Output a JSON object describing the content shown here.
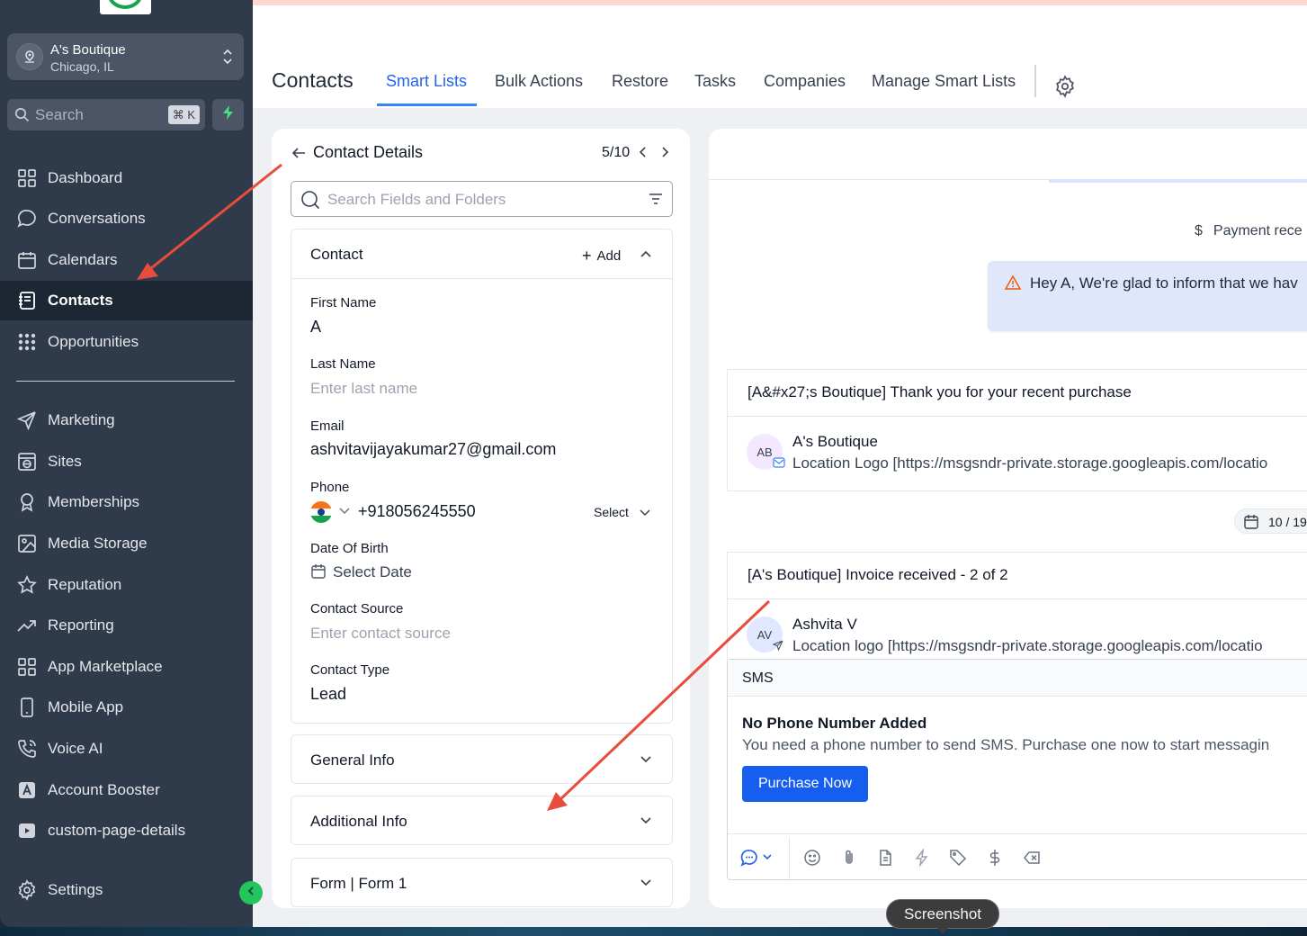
{
  "sidebar": {
    "location": {
      "name": "A's Boutique",
      "city": "Chicago, IL"
    },
    "search": {
      "placeholder": "Search",
      "shortcut": "⌘ K"
    },
    "items": [
      {
        "label": "Dashboard",
        "icon": "grid-icon"
      },
      {
        "label": "Conversations",
        "icon": "chat-bubble-icon"
      },
      {
        "label": "Calendars",
        "icon": "calendar-icon"
      },
      {
        "label": "Contacts",
        "icon": "contact-book-icon",
        "active": true
      },
      {
        "label": "Opportunities",
        "icon": "opportunities-icon"
      },
      {
        "label": "Marketing",
        "icon": "send-icon"
      },
      {
        "label": "Sites",
        "icon": "globe-window-icon"
      },
      {
        "label": "Memberships",
        "icon": "award-icon"
      },
      {
        "label": "Media Storage",
        "icon": "image-icon"
      },
      {
        "label": "Reputation",
        "icon": "star-icon"
      },
      {
        "label": "Reporting",
        "icon": "trend-icon"
      },
      {
        "label": "App Marketplace",
        "icon": "grid-icon"
      },
      {
        "label": "Mobile App",
        "icon": "phone-device-icon"
      },
      {
        "label": "Voice AI",
        "icon": "phone-wave-icon"
      },
      {
        "label": "Account Booster",
        "icon": "booster-icon"
      },
      {
        "label": "custom-page-details",
        "icon": "play-box-icon"
      }
    ],
    "settings_label": "Settings"
  },
  "header": {
    "title": "Contacts",
    "tabs": [
      {
        "label": "Smart Lists",
        "active": true
      },
      {
        "label": "Bulk Actions"
      },
      {
        "label": "Restore"
      },
      {
        "label": "Tasks"
      },
      {
        "label": "Companies"
      },
      {
        "label": "Manage Smart Lists"
      }
    ]
  },
  "contact_details": {
    "title": "Contact Details",
    "pager": "5/10",
    "search_placeholder": "Search Fields and Folders",
    "contact_section": {
      "title": "Contact",
      "add_label": "Add",
      "fields": {
        "first_name": {
          "label": "First Name",
          "value": "A"
        },
        "last_name": {
          "label": "Last Name",
          "placeholder": "Enter last name"
        },
        "email": {
          "label": "Email",
          "value": "ashvitavijayakumar27@gmail.com"
        },
        "phone": {
          "label": "Phone",
          "value": "+918056245550",
          "type_select": "Select"
        },
        "dob": {
          "label": "Date Of Birth",
          "placeholder": "Select Date"
        },
        "source": {
          "label": "Contact Source",
          "placeholder": "Enter contact source"
        },
        "type": {
          "label": "Contact Type",
          "value": "Lead"
        }
      }
    },
    "collapsed_sections": [
      "General Info",
      "Additional Info",
      "Form | Form 1"
    ]
  },
  "conversation": {
    "payment_text": "Payment rece",
    "warning_message": "Hey A, We're glad to inform that we hav",
    "emails": [
      {
        "subject": "[A&#x27;s Boutique] Thank you for your recent purchase",
        "avatar": "AB",
        "sender": "A's Boutique",
        "preview": "Location Logo [https://msgsndr-private.storage.googleapis.com/locatio"
      },
      {
        "subject": "[A's Boutique] Invoice received - 2 of 2",
        "avatar": "AV",
        "sender": "Ashvita V",
        "preview": "Location logo [https://msgsndr-private.storage.googleapis.com/locatio"
      }
    ],
    "date_pill": "10 / 19",
    "composer": {
      "channel": "SMS",
      "no_phone_title": "No Phone Number Added",
      "no_phone_desc": "You need a phone number to send SMS. Purchase one now to start messagin",
      "purchase_label": "Purchase Now"
    }
  },
  "tooltip": "Screenshot",
  "colors": {
    "sidebar_bg": "#2f3a4b",
    "active_tab": "#2563eb",
    "primary_button": "#155eef",
    "annotation_arrow": "#e74c3c",
    "collapse_toggle": "#22c55e"
  }
}
